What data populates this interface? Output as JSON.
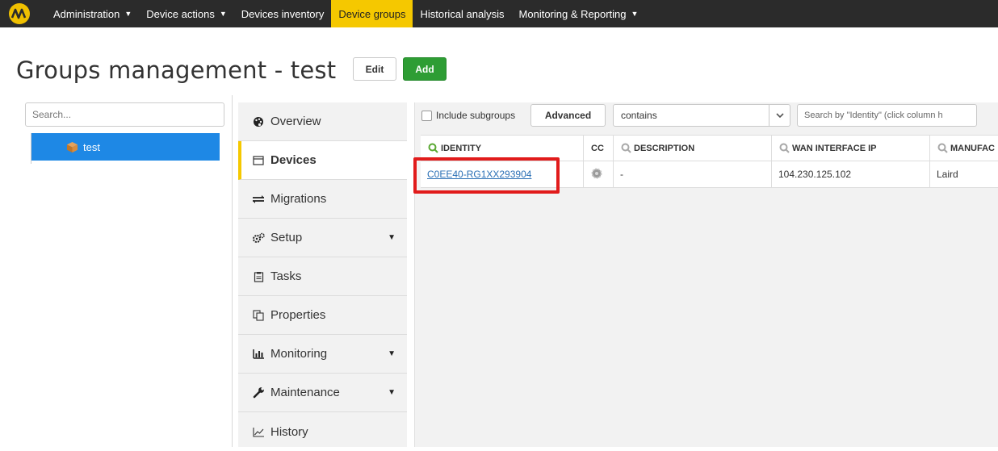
{
  "nav": {
    "items": [
      {
        "label": "Administration",
        "caret": true
      },
      {
        "label": "Device actions",
        "caret": true
      },
      {
        "label": "Devices inventory",
        "caret": false
      },
      {
        "label": "Device groups",
        "caret": false,
        "active": true
      },
      {
        "label": "Historical analysis",
        "caret": false
      },
      {
        "label": "Monitoring & Reporting",
        "caret": true
      }
    ],
    "accent": "#f5c800"
  },
  "page": {
    "title": "Groups management - test",
    "edit_label": "Edit",
    "add_label": "Add"
  },
  "tree": {
    "search_placeholder": "Search...",
    "node_label": "test"
  },
  "menu": {
    "items": [
      {
        "label": "Overview",
        "icon": "palette-icon"
      },
      {
        "label": "Devices",
        "icon": "window-icon",
        "active": true
      },
      {
        "label": "Migrations",
        "icon": "migrate-icon"
      },
      {
        "label": "Setup",
        "icon": "cogs-icon",
        "caret": true
      },
      {
        "label": "Tasks",
        "icon": "clipboard-icon"
      },
      {
        "label": "Properties",
        "icon": "copy-icon"
      },
      {
        "label": "Monitoring",
        "icon": "bar-chart-icon",
        "caret": true
      },
      {
        "label": "Maintenance",
        "icon": "wrench-icon",
        "caret": true
      },
      {
        "label": "History",
        "icon": "line-chart-icon"
      }
    ]
  },
  "filters": {
    "include_subgroups": "Include subgroups",
    "advanced": "Advanced",
    "operator": "contains",
    "search_placeholder": "Search by \"Identity\" (click column h"
  },
  "table": {
    "headers": [
      "IDENTITY",
      "CC",
      "DESCRIPTION",
      "WAN INTERFACE IP",
      "MANUFAC"
    ],
    "rows": [
      {
        "identity": "C0EE40-RG1XX293904",
        "description": "-",
        "wan_ip": "104.230.125.102",
        "manufacturer": "Laird"
      }
    ]
  }
}
